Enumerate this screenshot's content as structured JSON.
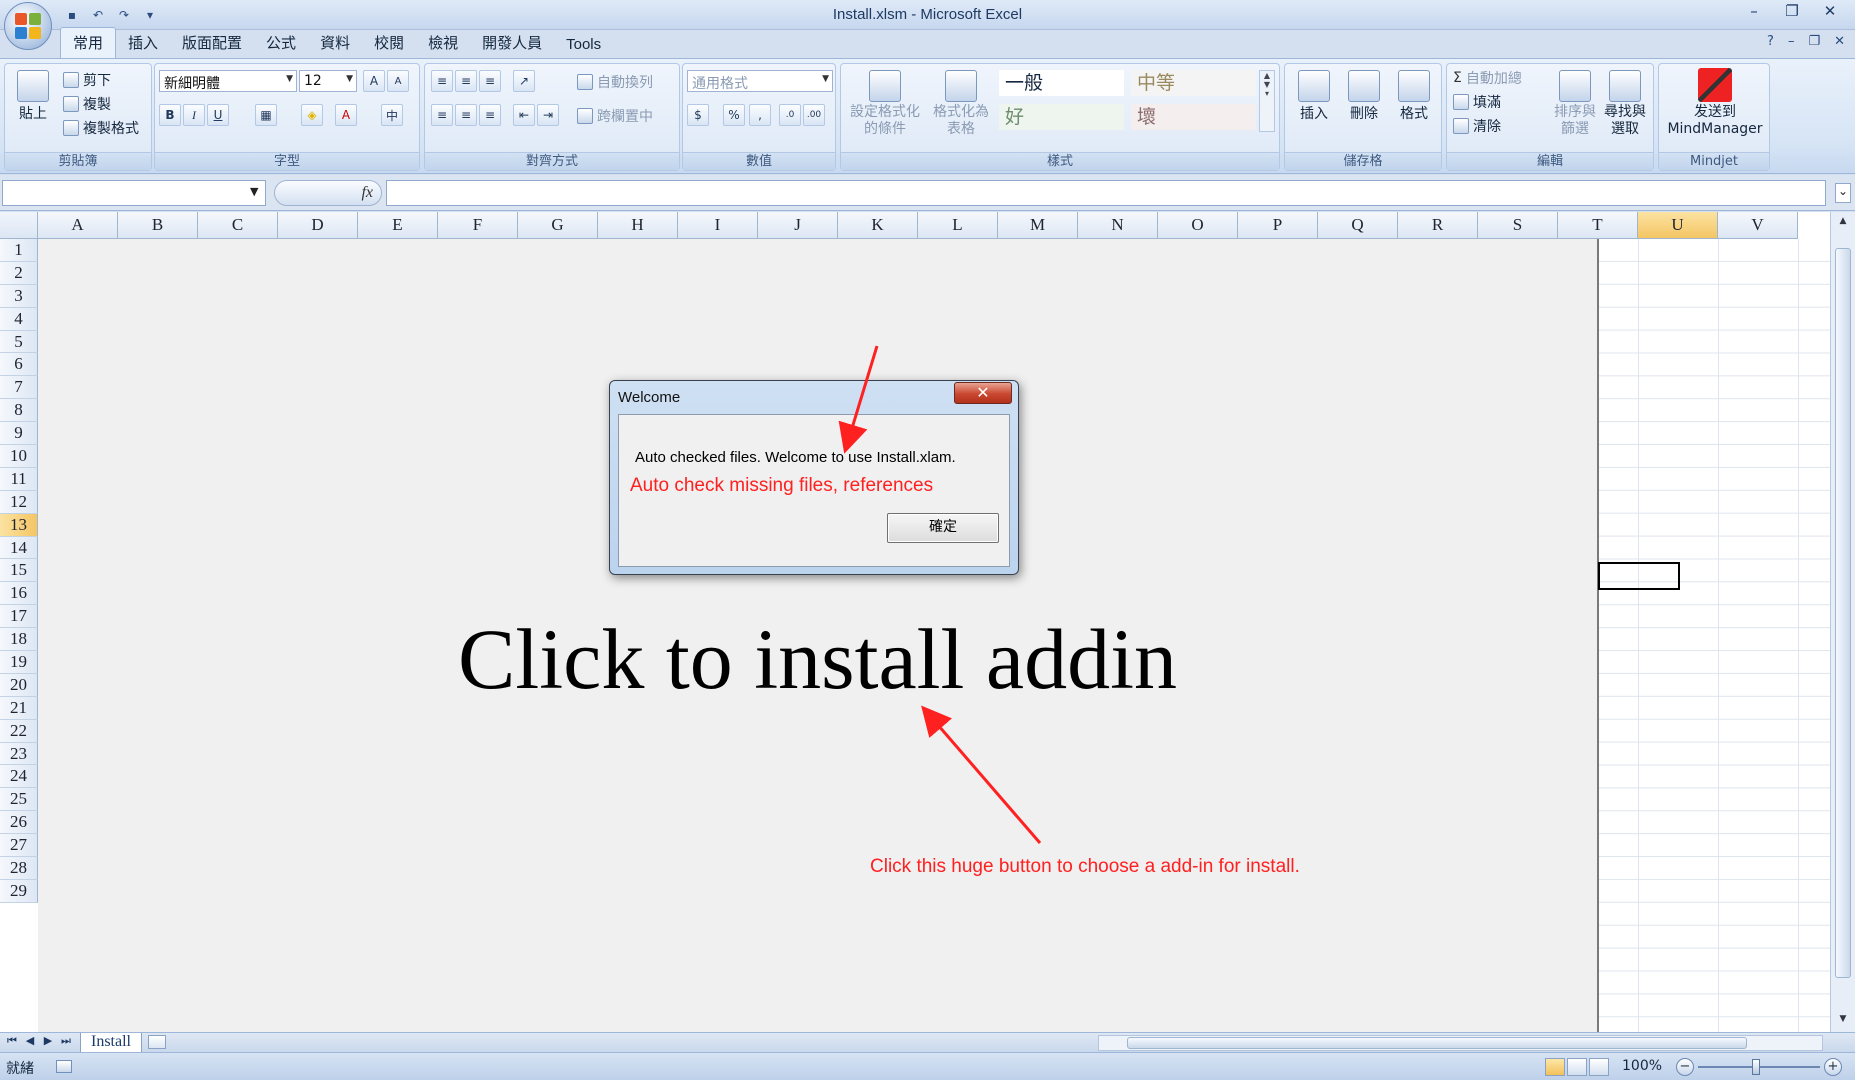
{
  "window": {
    "title": "Install.xlsm - Microsoft Excel"
  },
  "quick_access": {
    "save_icon": "save-icon",
    "undo_icon": "undo-icon",
    "redo_icon": "redo-icon"
  },
  "menu_tabs": [
    "常用",
    "插入",
    "版面配置",
    "公式",
    "資料",
    "校閱",
    "檢視",
    "開發人員",
    "Tools"
  ],
  "active_tab": "常用",
  "ribbon": {
    "clipboard": {
      "label": "剪貼簿",
      "paste": "貼上",
      "cut": "剪下",
      "copy": "複製",
      "format_painter": "複製格式"
    },
    "font": {
      "label": "字型",
      "font_name": "新細明體",
      "font_size": "12",
      "bold": "B",
      "italic": "I",
      "underline": "U"
    },
    "alignment": {
      "label": "對齊方式",
      "wrap_text": "自動換列",
      "merge_center": "跨欄置中"
    },
    "number": {
      "label": "數值",
      "format": "通用格式",
      "currency": "$",
      "percent": "%",
      "comma": ","
    },
    "styles": {
      "label": "樣式",
      "conditional": "設定格式化",
      "conditional_2": "的條件",
      "format_table": "格式化為",
      "format_table_2": "表格",
      "normal": "一般",
      "neutral": "中等",
      "good": "好",
      "bad": "壞"
    },
    "cells": {
      "label": "儲存格",
      "insert": "插入",
      "delete": "刪除",
      "format": "格式"
    },
    "editing": {
      "label": "編輯",
      "autosum": "自動加總",
      "fill": "填滿",
      "clear": "清除",
      "sort": "排序與",
      "sort_2": "篩選",
      "find": "尋找與",
      "find_2": "選取"
    },
    "mindjet": {
      "label": "Mindjet",
      "send": "发送到",
      "send_2": "MindManager"
    }
  },
  "formula_bar": {
    "fx": "fx",
    "name_box": "",
    "value": ""
  },
  "columns": [
    "A",
    "B",
    "C",
    "D",
    "E",
    "F",
    "G",
    "H",
    "I",
    "J",
    "K",
    "L",
    "M",
    "N",
    "O",
    "P",
    "Q",
    "R",
    "S",
    "T",
    "U",
    "V"
  ],
  "selected_column": "U",
  "rows": [
    "1",
    "2",
    "3",
    "4",
    "5",
    "6",
    "7",
    "8",
    "9",
    "10",
    "11",
    "12",
    "13",
    "14",
    "15",
    "16",
    "17",
    "18",
    "19",
    "20",
    "21",
    "22",
    "23",
    "24",
    "25",
    "26",
    "27",
    "28",
    "29"
  ],
  "selected_row": "13",
  "install_button": {
    "label": "Click to install addin"
  },
  "dialog": {
    "title": "Welcome",
    "message": "Auto checked files. Welcome to use Install.xlam.",
    "ok_label": "確定",
    "close_glyph": "✕"
  },
  "annotations": {
    "dialog_note": "Auto check missing files, references",
    "button_note": "Click this huge button to choose a add-in for install.",
    "color": "#ff2020"
  },
  "sheet_tabs": {
    "active": "Install"
  },
  "status": {
    "ready": "就緒",
    "zoom": "100%"
  }
}
